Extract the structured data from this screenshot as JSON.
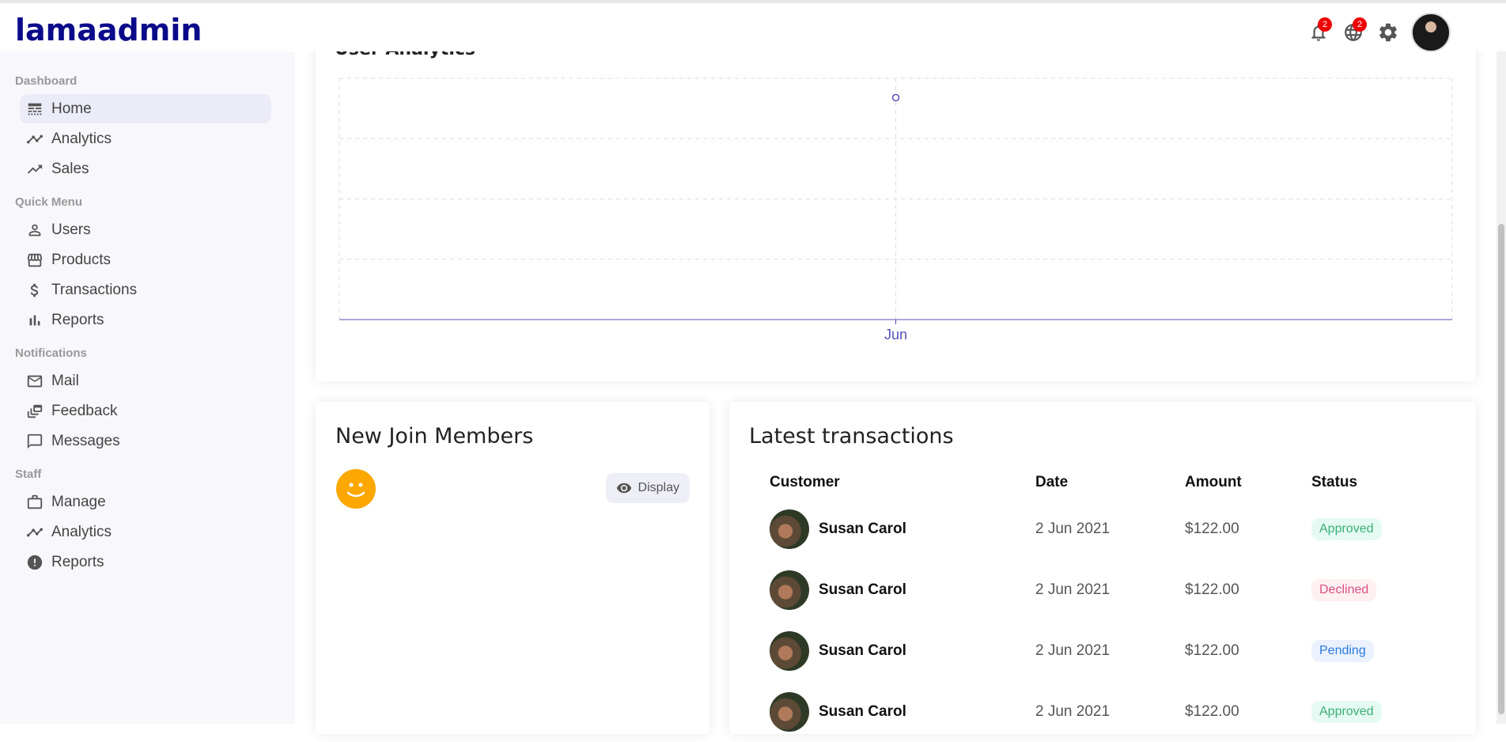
{
  "app": {
    "logo": "lamaadmin"
  },
  "topbar": {
    "notifications_count": "2",
    "language_count": "2"
  },
  "sidebar": {
    "sections": [
      {
        "title": "Dashboard",
        "items": [
          {
            "label": "Home",
            "icon": "line-style-icon",
            "active": true
          },
          {
            "label": "Analytics",
            "icon": "timeline-icon"
          },
          {
            "label": "Sales",
            "icon": "trending-up-icon"
          }
        ]
      },
      {
        "title": "Quick Menu",
        "items": [
          {
            "label": "Users",
            "icon": "person-outline-icon"
          },
          {
            "label": "Products",
            "icon": "storefront-icon"
          },
          {
            "label": "Transactions",
            "icon": "dollar-icon"
          },
          {
            "label": "Reports",
            "icon": "bar-chart-icon"
          }
        ]
      },
      {
        "title": "Notifications",
        "items": [
          {
            "label": "Mail",
            "icon": "mail-outline-icon"
          },
          {
            "label": "Feedback",
            "icon": "dynamic-feed-icon"
          },
          {
            "label": "Messages",
            "icon": "chat-bubble-outline-icon"
          }
        ]
      },
      {
        "title": "Staff",
        "items": [
          {
            "label": "Manage",
            "icon": "work-outline-icon"
          },
          {
            "label": "Analytics",
            "icon": "timeline-icon"
          },
          {
            "label": "Reports",
            "icon": "report-icon"
          }
        ]
      }
    ]
  },
  "analytics": {
    "title": "User Analytics",
    "chart_data": {
      "type": "line",
      "title": "User Analytics",
      "categories": [
        "Jun"
      ],
      "series": [
        {
          "values": [
            1
          ]
        }
      ],
      "grid": true,
      "color": "#5550bd"
    }
  },
  "members": {
    "title": "New Join Members",
    "display_label": "Display"
  },
  "transactions": {
    "title": "Latest transactions",
    "headers": [
      "Customer",
      "Date",
      "Amount",
      "Status"
    ],
    "rows": [
      {
        "customer": "Susan Carol",
        "date": "2 Jun 2021",
        "amount": "$122.00",
        "status": "Approved"
      },
      {
        "customer": "Susan Carol",
        "date": "2 Jun 2021",
        "amount": "$122.00",
        "status": "Declined"
      },
      {
        "customer": "Susan Carol",
        "date": "2 Jun 2021",
        "amount": "$122.00",
        "status": "Pending"
      },
      {
        "customer": "Susan Carol",
        "date": "2 Jun 2021",
        "amount": "$122.00",
        "status": "Approved"
      }
    ]
  },
  "colors": {
    "accent": "#0a0a8a",
    "chart_line": "#5550bd",
    "badge": "#ee0000"
  }
}
